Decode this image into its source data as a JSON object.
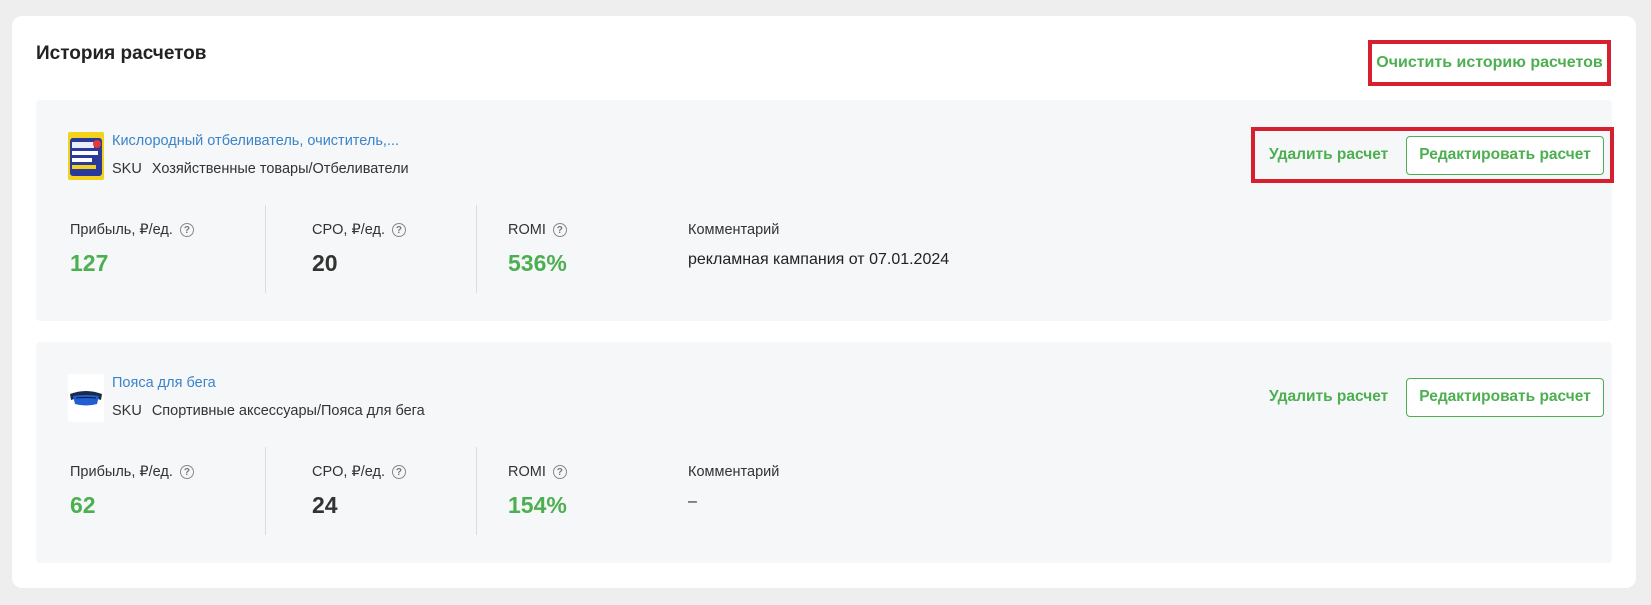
{
  "page": {
    "title": "История расчетов",
    "clear_history_label": "Очистить историю расчетов"
  },
  "calculations": [
    {
      "product_name": "Кислородный отбеливатель, очиститель,...",
      "sku_label": "SKU",
      "category": "Хозяйственные товары/Отбеливатели",
      "delete_label": "Удалить расчет",
      "edit_label": "Редактировать расчет",
      "profit_label": "Прибыль, ₽/ед.",
      "profit_value": "127",
      "cpo_label": "CPO, ₽/ед.",
      "cpo_value": "20",
      "romi_label": "ROMI",
      "romi_value": "536%",
      "comment_label": "Комментарий",
      "comment_value": "рекламная кампания от 07.01.2024"
    },
    {
      "product_name": "Пояса для бега",
      "sku_label": "SKU",
      "category": "Спортивные аксессуары/Пояса для бега",
      "delete_label": "Удалить расчет",
      "edit_label": "Редактировать расчет",
      "profit_label": "Прибыль, ₽/ед.",
      "profit_value": "62",
      "cpo_label": "CPO, ₽/ед.",
      "cpo_value": "24",
      "romi_label": "ROMI",
      "romi_value": "154%",
      "comment_label": "Комментарий",
      "comment_value": "–"
    }
  ],
  "colors": {
    "accent_green": "#4caf50",
    "link_blue": "#3a84c9",
    "highlight_red": "#d7202f",
    "card_bg": "#f6f7f9"
  },
  "icons": {
    "help": "question-circle-icon"
  }
}
